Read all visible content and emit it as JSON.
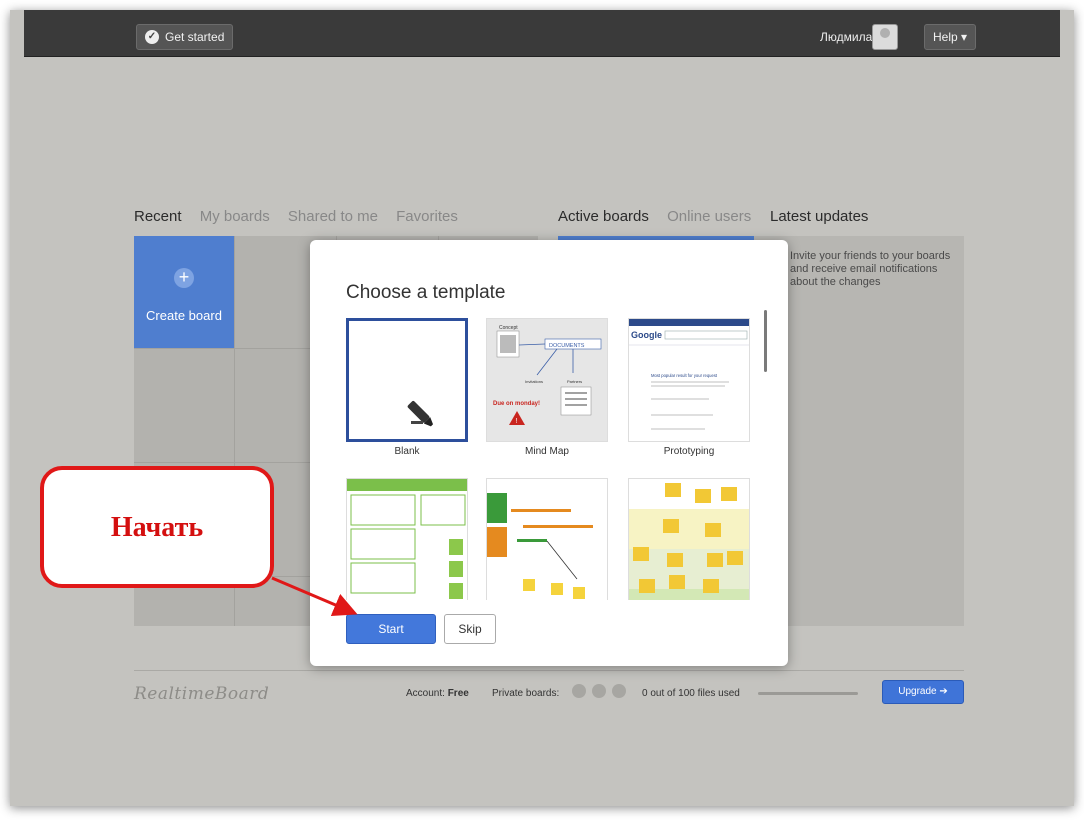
{
  "topbar": {
    "get_started": "Get started",
    "user_name": "Людмила ▾",
    "help": "Help ▾"
  },
  "tabs_left": [
    "Recent",
    "My boards",
    "Shared to me",
    "Favorites"
  ],
  "tabs_right": [
    "Active boards",
    "Online users"
  ],
  "latest_updates_title": "Latest updates",
  "create_board": {
    "plus": "+",
    "label": "Create board"
  },
  "updates_text": "Invite your friends to your boards and receive email notifications about the changes",
  "modal": {
    "title": "Choose a template",
    "templates": [
      {
        "label": "Blank",
        "selected": true
      },
      {
        "label": "Mind Map",
        "selected": false
      },
      {
        "label": "Prototyping",
        "selected": false
      },
      {
        "label": "",
        "selected": false
      },
      {
        "label": "",
        "selected": false
      },
      {
        "label": "",
        "selected": false
      }
    ],
    "mindmap_text": {
      "concept": "Concept",
      "documents": "DOCUMENTS",
      "invitations": "Invitations",
      "partners": "Partners",
      "due": "Due on monday!"
    },
    "proto_text": {
      "google": "Google",
      "result": "Most popular result for your request"
    },
    "start_label": "Start",
    "skip_label": "Skip"
  },
  "footer": {
    "logo": "RealtimeBoard",
    "account_label": "Account:",
    "account_value": "Free",
    "private_boards": "Private boards:",
    "files_used": "0 out of 100 files used",
    "upgrade": "Upgrade ➔"
  },
  "callout": {
    "text": "Начать"
  },
  "colors": {
    "accent_blue": "#4378db",
    "callout_red": "#e01818",
    "background": "#c4c3bf",
    "topbar": "#3a3a3a"
  }
}
